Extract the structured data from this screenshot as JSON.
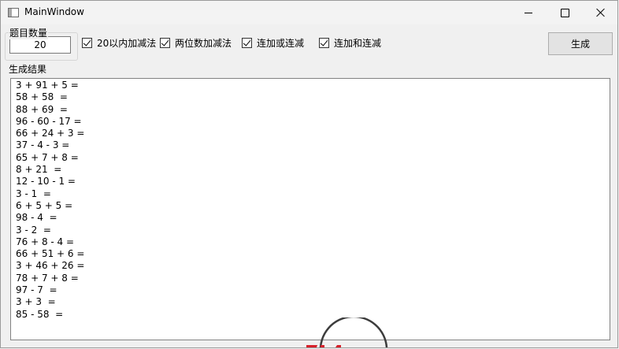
{
  "window": {
    "title": "MainWindow"
  },
  "count_group": {
    "label": "题目数量",
    "value": "20"
  },
  "options": [
    {
      "label": "20以内加减法",
      "checked": true
    },
    {
      "label": "两位数加减法",
      "checked": true
    },
    {
      "label": "连加或连减",
      "checked": true
    },
    {
      "label": "连加和连减",
      "checked": true
    }
  ],
  "generate_button": {
    "label": "生成"
  },
  "result": {
    "label": "生成结果",
    "lines": [
      "3 + 91 + 5 =",
      "58 + 58  =",
      "88 + 69  =",
      "96 - 60 - 17 =",
      "66 + 24 + 3 =",
      "37 - 4 - 3 =",
      "65 + 7 + 8 =",
      "8 + 21  =",
      "12 - 10 - 1 =",
      "3 - 1  =",
      "6 + 5 + 5 =",
      "98 - 4  =",
      "3 - 2  =",
      "76 + 8 - 4 =",
      "66 + 51 + 6 =",
      "3 + 46 + 26 =",
      "78 + 7 + 8 =",
      "97 - 7  =",
      "3 + 3  =",
      "85 - 58  ="
    ]
  },
  "icons": [
    "app-window-icon",
    "minimize-icon",
    "maximize-icon",
    "close-icon",
    "checkmark-icon"
  ],
  "colors": {
    "logo_accent": "#d6202a",
    "logo_ring": "#3c3c3c"
  }
}
